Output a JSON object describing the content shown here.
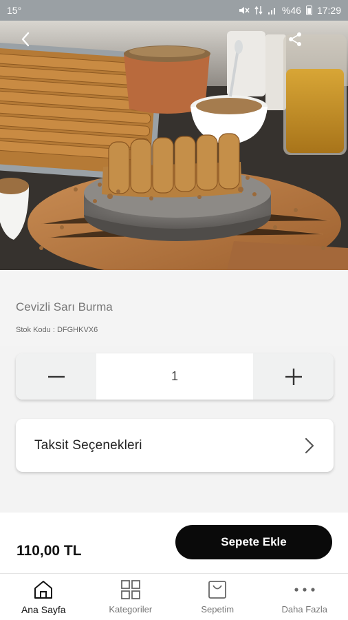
{
  "status_bar": {
    "left": "15°",
    "battery": "%46",
    "time": "17:29"
  },
  "product": {
    "name": "Cevizli Sarı Burma",
    "stock_label": "Stok Kodu :",
    "stock_code": "DFGHKVX6",
    "image_icons": [
      "back-arrow-icon",
      "share-icon"
    ]
  },
  "quantity": {
    "value": "1",
    "minus_icon": "minus-icon",
    "plus_icon": "plus-icon"
  },
  "taksit": {
    "label": "Taksit Seçenekleri"
  },
  "purchase": {
    "price": "110,00 TL",
    "add_to_cart": "Sepete Ekle",
    "button_color": "#0a0a0a"
  },
  "tabs": [
    {
      "label": "Ana Sayfa",
      "icon": "home-icon",
      "active": true
    },
    {
      "label": "Kategoriler",
      "icon": "grid-icon",
      "active": false
    },
    {
      "label": "Sepetim",
      "icon": "shopping-bag-icon",
      "active": false
    },
    {
      "label": "Daha Fazla",
      "icon": "more-dots-icon",
      "active": false
    }
  ]
}
